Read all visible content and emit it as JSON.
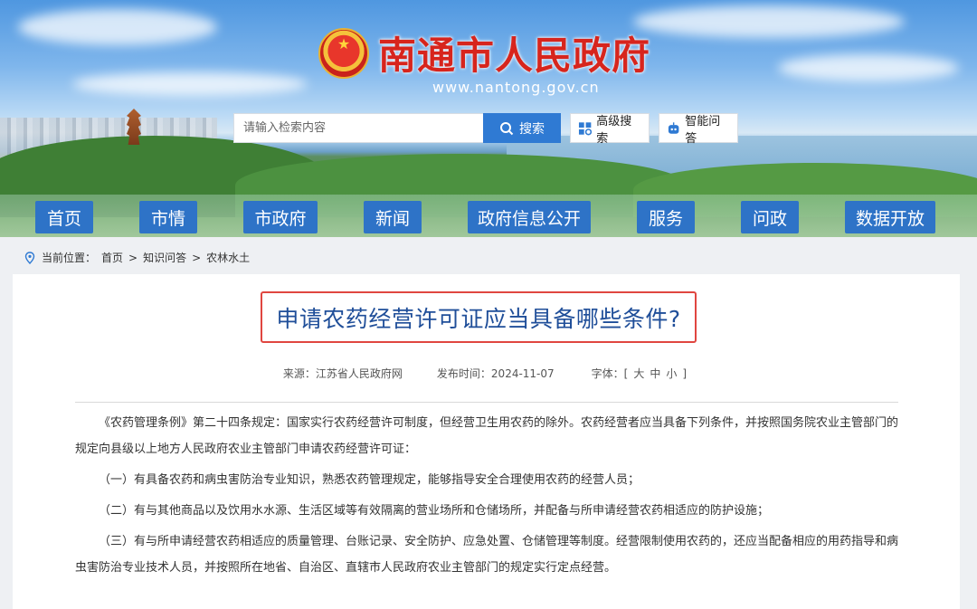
{
  "header": {
    "site_name": "南通市人民政府",
    "site_url": "www.nantong.gov.cn"
  },
  "search": {
    "placeholder": "请输入检索内容",
    "button_label": "搜索",
    "advanced_label": "高级搜索",
    "smart_qa_label": "智能问答"
  },
  "nav": {
    "items": [
      {
        "label": "首页"
      },
      {
        "label": "市情"
      },
      {
        "label": "市政府"
      },
      {
        "label": "新闻"
      },
      {
        "label": "政府信息公开"
      },
      {
        "label": "服务"
      },
      {
        "label": "问政"
      },
      {
        "label": "数据开放"
      }
    ]
  },
  "breadcrumb": {
    "prefix": "当前位置：",
    "items": [
      "首页",
      "知识问答",
      "农林水土"
    ],
    "separator": ">"
  },
  "article": {
    "title": "申请农药经营许可证应当具备哪些条件?",
    "source": "来源：江苏省人民政府网",
    "date": "发布时间：2024-11-07",
    "font_label": "字体：[",
    "font_sizes": [
      "大",
      "中",
      "小"
    ],
    "font_close": "]",
    "paragraphs": [
      "《农药管理条例》第二十四条规定：国家实行农药经营许可制度，但经营卫生用农药的除外。农药经营者应当具备下列条件，并按照国务院农业主管部门的规定向县级以上地方人民政府农业主管部门申请农药经营许可证：",
      "（一）有具备农药和病虫害防治专业知识，熟悉农药管理规定，能够指导安全合理使用农药的经营人员；",
      "（二）有与其他商品以及饮用水水源、生活区域等有效隔离的营业场所和仓储场所，并配备与所申请经营农药相适应的防护设施；",
      "（三）有与所申请经营农药相适应的质量管理、台账记录、安全防护、应急处置、仓储管理等制度。经营限制使用农药的，还应当配备相应的用药指导和病虫害防治专业技术人员，并按照所在地省、自治区、直辖市人民政府农业主管部门的规定实行定点经营。"
    ]
  },
  "colors": {
    "brand_red": "#d7251d",
    "nav_blue": "#2e73c7",
    "title_blue": "#1f4e99",
    "title_border": "#e04640"
  }
}
